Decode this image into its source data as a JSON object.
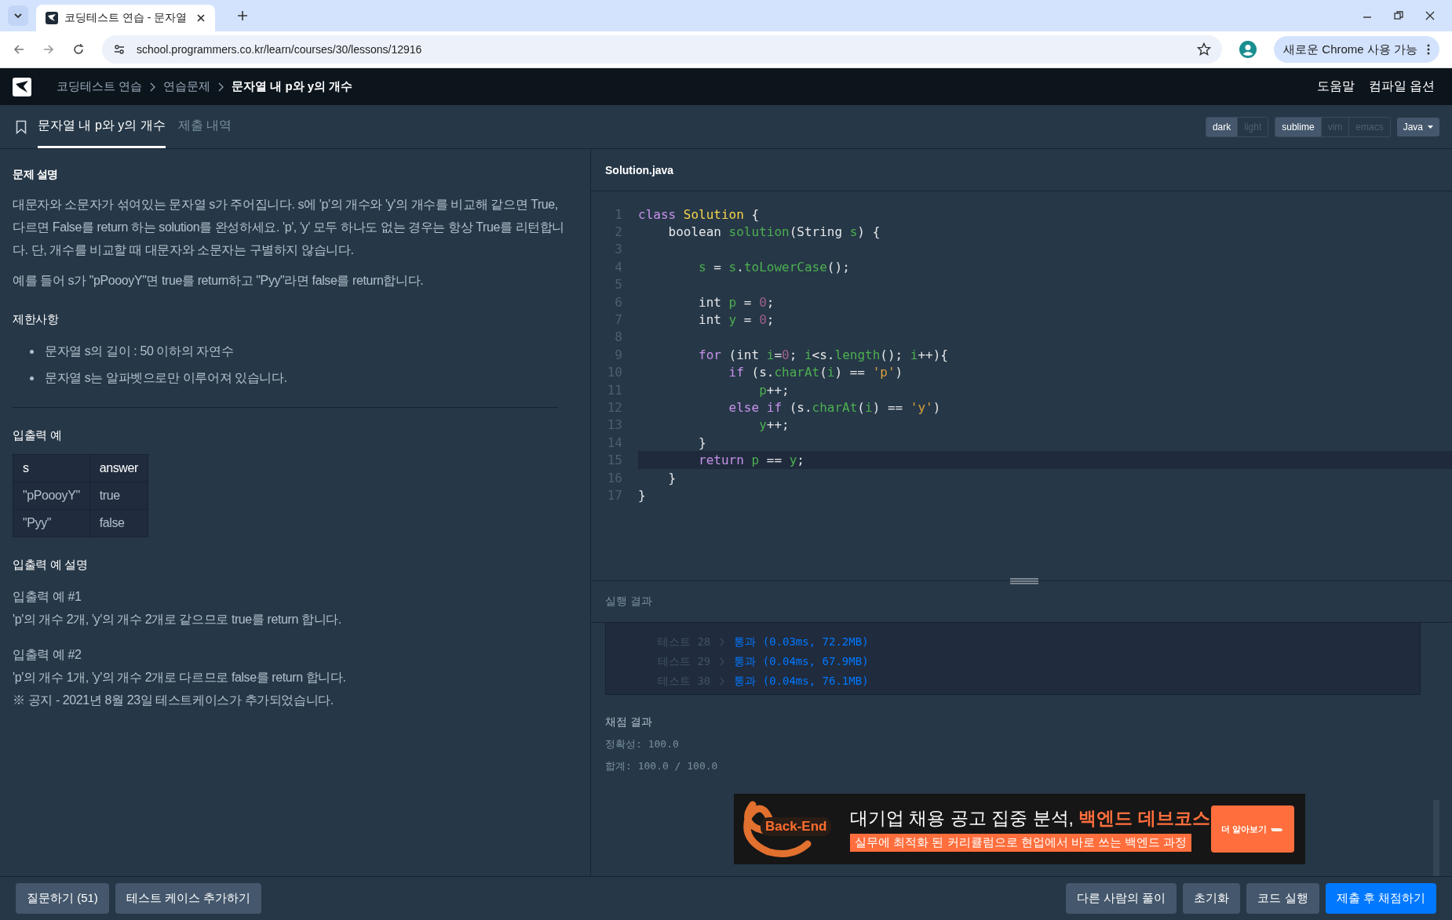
{
  "browser": {
    "tab_title": "코딩테스트 연습 - 문자열",
    "url": "school.programmers.co.kr/learn/courses/30/lessons/12916",
    "update_button": "새로운 Chrome 사용 가능"
  },
  "nav": {
    "breadcrumbs": [
      "코딩테스트 연습",
      "연습문제"
    ],
    "current": "문자열 내 p와 y의 개수",
    "links": [
      "도움말",
      "컴파일 옵션"
    ]
  },
  "problem_tabs": [
    {
      "label": "문자열 내 p와 y의 개수",
      "selected": true
    },
    {
      "label": "제출 내역",
      "selected": false
    }
  ],
  "editor_settings": {
    "themes": [
      {
        "label": "dark",
        "selected": true
      },
      {
        "label": "light",
        "selected": false
      }
    ],
    "keymaps": [
      {
        "label": "sublime",
        "selected": true
      },
      {
        "label": "vim",
        "selected": false
      },
      {
        "label": "emacs",
        "selected": false
      }
    ],
    "language": "Java"
  },
  "description": {
    "title": "문제 설명",
    "paragraphs": [
      "대문자와 소문자가 섞여있는 문자열 s가 주어집니다. s에 'p'의 개수와 'y'의 개수를 비교해 같으면 True, 다르면 False를 return 하는 solution를 완성하세요. 'p', 'y' 모두 하나도 없는 경우는 항상 True를 리턴합니다. 단, 개수를 비교할 때 대문자와 소문자는 구별하지 않습니다.",
      "예를 들어 s가 \"pPoooyY\"면 true를 return하고 \"Pyy\"라면 false를 return합니다."
    ],
    "constraints_title": "제한사항",
    "constraints": [
      "문자열 s의 길이 : 50 이하의 자연수",
      "문자열 s는 알파벳으로만 이루어져 있습니다."
    ],
    "examples_title": "입출력 예",
    "examples_table": {
      "columns": [
        "s",
        "answer"
      ],
      "rows": [
        [
          "\"pPoooyY\"",
          "true"
        ],
        [
          "\"Pyy\"",
          "false"
        ]
      ]
    },
    "explanation_title": "입출력 예 설명",
    "explanations": [
      {
        "title": "입출력 예 #1",
        "text": "'p'의 개수 2개, 'y'의 개수 2개로 같으므로 true를 return 합니다."
      },
      {
        "title": "입출력 예 #2",
        "text": "'p'의 개수 1개, 'y'의 개수 2개로 다르므로 false를 return 합니다."
      }
    ],
    "notice": "※ 공지 - 2021년 8월 23일 테스트케이스가 추가되었습니다."
  },
  "editor": {
    "filename": "Solution.java",
    "lines": [
      {
        "number": "1",
        "highlighted": false,
        "tokens": [
          {
            "kind": "keyword",
            "text": "class "
          },
          {
            "kind": "class",
            "text": "Solution"
          },
          {
            "kind": "plain",
            "text": " {"
          }
        ]
      },
      {
        "number": "2",
        "highlighted": false,
        "tokens": [
          {
            "kind": "plain",
            "text": "    boolean "
          },
          {
            "kind": "name",
            "text": "solution"
          },
          {
            "kind": "plain",
            "text": "(String "
          },
          {
            "kind": "name",
            "text": "s"
          },
          {
            "kind": "plain",
            "text": ") {"
          }
        ]
      },
      {
        "number": "3",
        "highlighted": false
      },
      {
        "number": "4",
        "highlighted": false,
        "tokens": [
          {
            "kind": "name",
            "text": "        s"
          },
          {
            "kind": "plain",
            "text": " = "
          },
          {
            "kind": "name",
            "text": "s"
          },
          {
            "kind": "plain",
            "text": "."
          },
          {
            "kind": "name",
            "text": "toLowerCase"
          },
          {
            "kind": "plain",
            "text": "();"
          }
        ]
      },
      {
        "number": "5",
        "highlighted": false
      },
      {
        "number": "6",
        "highlighted": false,
        "tokens": [
          {
            "kind": "plain",
            "text": "        int "
          },
          {
            "kind": "name",
            "text": "p"
          },
          {
            "kind": "plain",
            "text": " = "
          },
          {
            "kind": "number",
            "text": "0"
          },
          {
            "kind": "plain",
            "text": ";"
          }
        ]
      },
      {
        "number": "7",
        "highlighted": false,
        "tokens": [
          {
            "kind": "plain",
            "text": "        int "
          },
          {
            "kind": "name",
            "text": "y"
          },
          {
            "kind": "plain",
            "text": " = "
          },
          {
            "kind": "number",
            "text": "0"
          },
          {
            "kind": "plain",
            "text": ";"
          }
        ]
      },
      {
        "number": "8",
        "highlighted": false
      },
      {
        "number": "9",
        "highlighted": false,
        "tokens": [
          {
            "kind": "keyword",
            "text": "        for"
          },
          {
            "kind": "plain",
            "text": " (int "
          },
          {
            "kind": "name",
            "text": "i"
          },
          {
            "kind": "plain",
            "text": "="
          },
          {
            "kind": "number",
            "text": "0"
          },
          {
            "kind": "plain",
            "text": "; "
          },
          {
            "kind": "name",
            "text": "i"
          },
          {
            "kind": "plain",
            "text": "<s."
          },
          {
            "kind": "name",
            "text": "length"
          },
          {
            "kind": "plain",
            "text": "(); "
          },
          {
            "kind": "name",
            "text": "i"
          },
          {
            "kind": "plain",
            "text": "++){"
          }
        ]
      },
      {
        "number": "10",
        "highlighted": false,
        "tokens": [
          {
            "kind": "keyword",
            "text": "            if"
          },
          {
            "kind": "plain",
            "text": " (s."
          },
          {
            "kind": "name",
            "text": "charAt"
          },
          {
            "kind": "plain",
            "text": "("
          },
          {
            "kind": "name",
            "text": "i"
          },
          {
            "kind": "plain",
            "text": ") == "
          },
          {
            "kind": "string",
            "text": "'p'"
          },
          {
            "kind": "plain",
            "text": ")"
          }
        ]
      },
      {
        "number": "11",
        "highlighted": false,
        "tokens": [
          {
            "kind": "name",
            "text": "                p"
          },
          {
            "kind": "plain",
            "text": "++;"
          }
        ]
      },
      {
        "number": "12",
        "highlighted": false,
        "tokens": [
          {
            "kind": "keyword",
            "text": "            else if"
          },
          {
            "kind": "plain",
            "text": " (s."
          },
          {
            "kind": "name",
            "text": "charAt"
          },
          {
            "kind": "plain",
            "text": "("
          },
          {
            "kind": "name",
            "text": "i"
          },
          {
            "kind": "plain",
            "text": ") == "
          },
          {
            "kind": "string",
            "text": "'y'"
          },
          {
            "kind": "plain",
            "text": ")"
          }
        ]
      },
      {
        "number": "13",
        "highlighted": false,
        "tokens": [
          {
            "kind": "name",
            "text": "                y"
          },
          {
            "kind": "plain",
            "text": "++;"
          }
        ]
      },
      {
        "number": "14",
        "highlighted": false,
        "tokens": [
          {
            "kind": "plain",
            "text": "        }"
          }
        ]
      },
      {
        "number": "15",
        "highlighted": true,
        "tokens": [
          {
            "kind": "keyword",
            "text": "        return "
          },
          {
            "kind": "name",
            "text": "p"
          },
          {
            "kind": "plain",
            "text": " == "
          },
          {
            "kind": "name",
            "text": "y"
          },
          {
            "kind": "plain",
            "text": ";"
          }
        ]
      },
      {
        "number": "16",
        "highlighted": false,
        "tokens": [
          {
            "kind": "plain",
            "text": "    }"
          }
        ]
      },
      {
        "number": "17",
        "highlighted": false,
        "tokens": [
          {
            "kind": "plain",
            "text": "}"
          }
        ]
      }
    ]
  },
  "results": {
    "title": "실행 결과",
    "tests": [
      {
        "label": "테스트 28",
        "result": "통과 (0.03ms, 72.2MB)"
      },
      {
        "label": "테스트 29",
        "result": "통과 (0.04ms, 67.9MB)"
      },
      {
        "label": "테스트 30",
        "result": "통과 (0.04ms, 76.1MB)"
      }
    ],
    "score_title": "채점 결과",
    "score_lines": [
      "정확성: 100.0",
      "합계: 100.0 / 100.0"
    ]
  },
  "ad": {
    "logo": "Back-End",
    "headline": "대기업 채용 공고 집중 분석, ",
    "headline_highlight": "백엔드 데브코스",
    "subline": "실무에 최적화 된 커리큘럼으로 현업에서 바로 쓰는 백엔드 과정",
    "button": "더 알아보기"
  },
  "bottom_bar": {
    "left_buttons": [
      {
        "label": "질문하기 (51)"
      },
      {
        "label": "테스트 케이스 추가하기"
      }
    ],
    "right_buttons": [
      {
        "label": "다른 사람의 풀이",
        "kind": "secondary"
      },
      {
        "label": "초기화",
        "kind": "secondary"
      },
      {
        "label": "코드 실행",
        "kind": "secondary"
      },
      {
        "label": "제출 후 채점하기",
        "kind": "primary"
      }
    ]
  }
}
